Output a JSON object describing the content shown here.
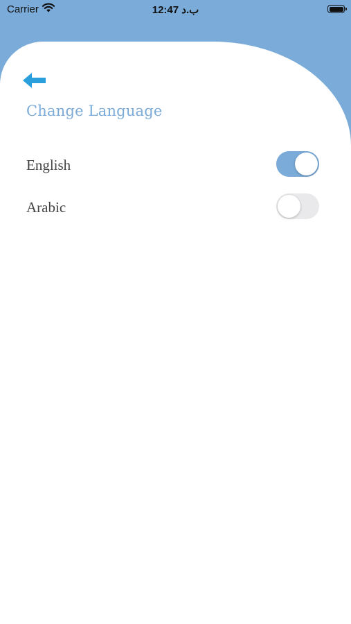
{
  "status_bar": {
    "carrier": "Carrier",
    "time": "ب.د 12:47"
  },
  "screen": {
    "title": "Change Language",
    "back_icon": "arrow-left-icon",
    "accent_color": "#7aabd9"
  },
  "languages": [
    {
      "label": "English",
      "enabled": true
    },
    {
      "label": "Arabic",
      "enabled": false
    }
  ]
}
